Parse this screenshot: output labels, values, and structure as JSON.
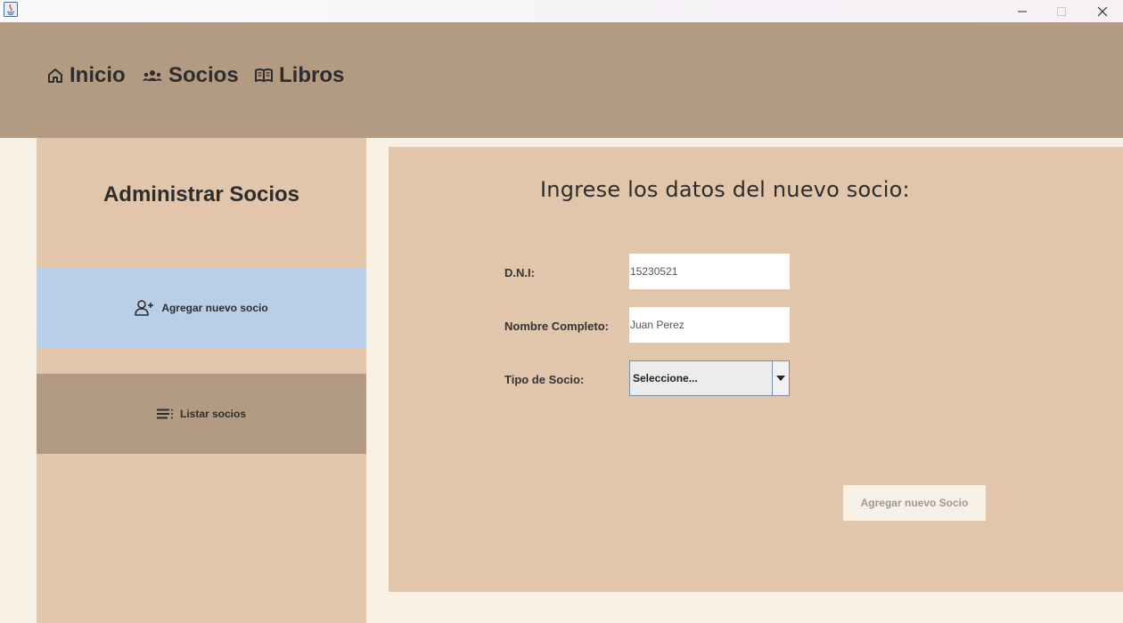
{
  "window": {
    "icons": {
      "app": "java-icon",
      "minimize": "minimize-icon",
      "maximize": "maximize-icon",
      "close": "close-icon"
    }
  },
  "nav": {
    "inicio": {
      "label": "Inicio",
      "icon": "home-icon"
    },
    "socios": {
      "label": "Socios",
      "icon": "group-icon"
    },
    "libros": {
      "label": "Libros",
      "icon": "book-icon"
    }
  },
  "sidebar": {
    "title": "Administrar Socios",
    "items": [
      {
        "label": "Agregar nuevo socio",
        "icon": "add-user-icon",
        "active": true
      },
      {
        "label": "Listar socios",
        "icon": "list-icon",
        "active": false
      }
    ]
  },
  "form": {
    "title": "Ingrese los datos del nuevo socio:",
    "dni": {
      "label": "D.N.I:",
      "value": "15230521"
    },
    "nombre": {
      "label": "Nombre Completo:",
      "value": "Juan Perez"
    },
    "tipo": {
      "label": "Tipo de Socio:",
      "selected": "Seleccione..."
    },
    "submit_label": "Agregar nuevo Socio"
  },
  "colors": {
    "header": "#b39a82",
    "sidebar": "#e2c6ab",
    "active_item": "#b9cfe7",
    "background": "#f8efe5"
  }
}
